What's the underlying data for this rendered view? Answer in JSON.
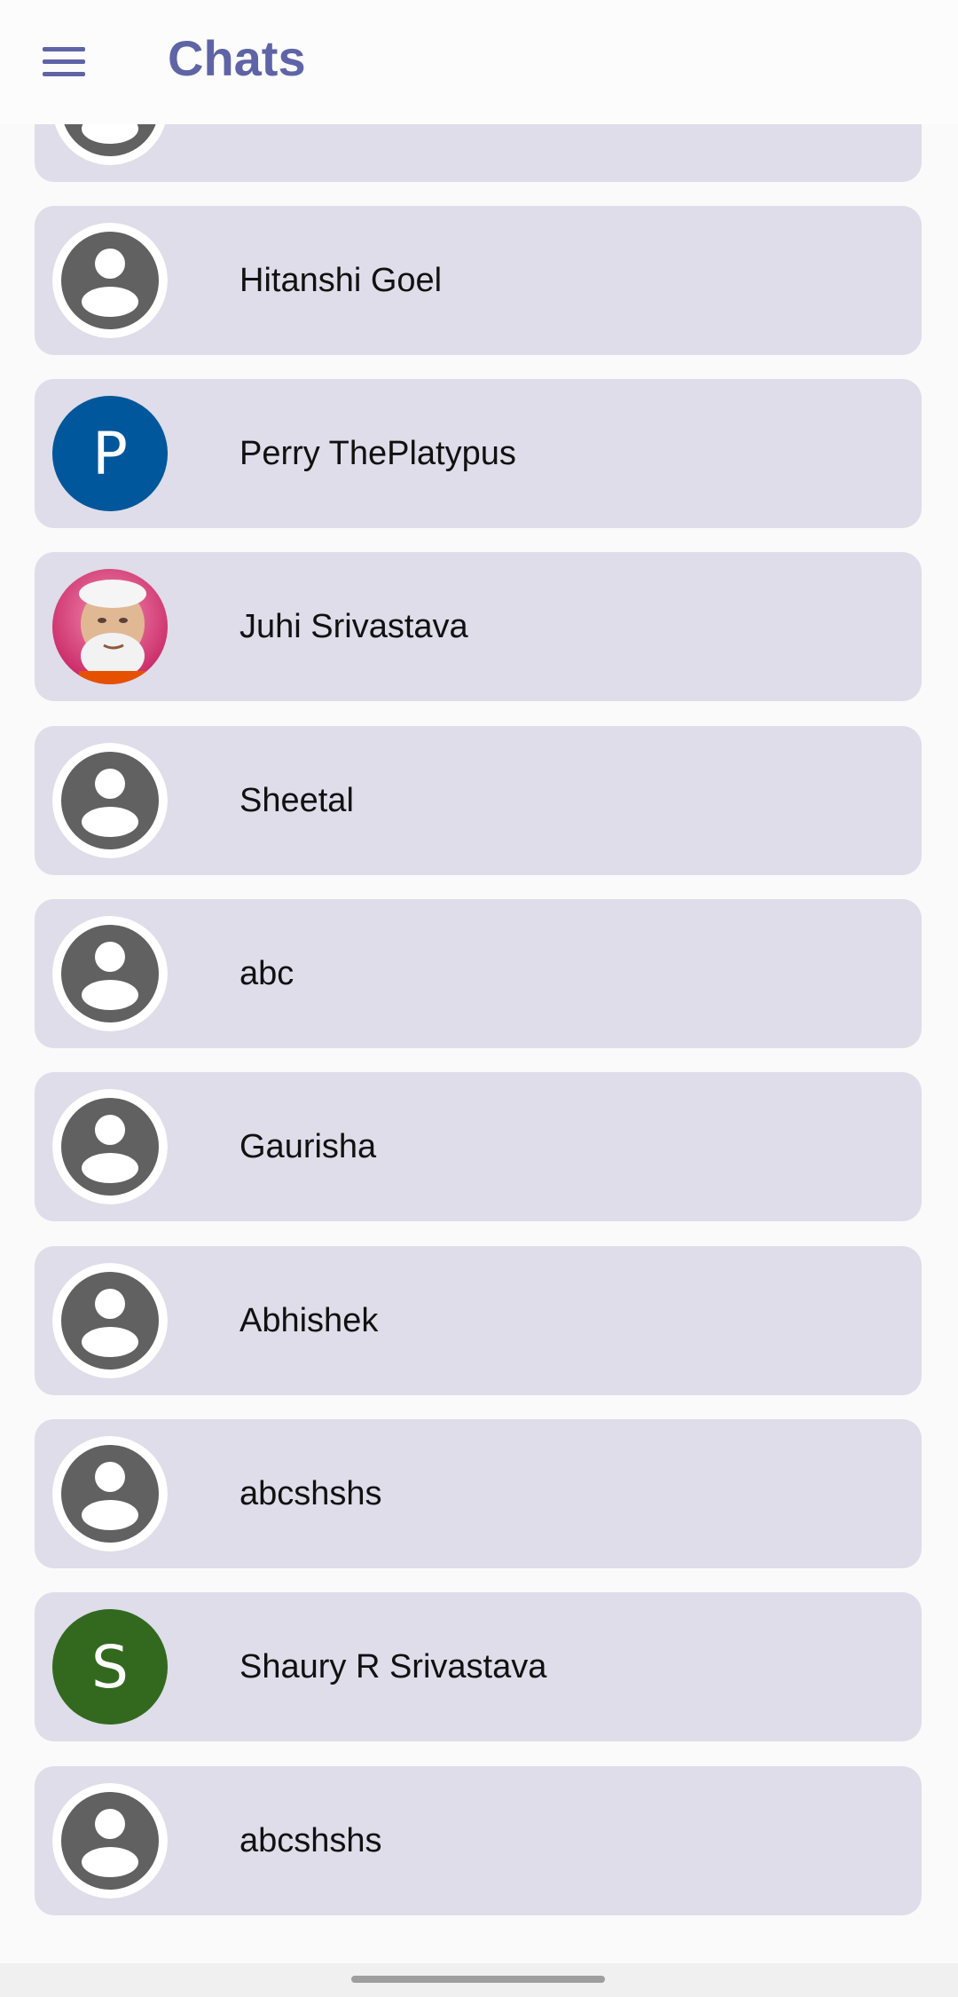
{
  "header": {
    "title": "Chats",
    "menu_icon": "hamburger-menu-icon"
  },
  "colors": {
    "accent": "#5e64a6",
    "card": "#dedde9",
    "default_avatar": "#616161",
    "avatar_p": "#01579b",
    "avatar_s": "#33691e"
  },
  "chats": [
    {
      "name": "",
      "avatar": "default-person-icon"
    },
    {
      "name": "Hitanshi Goel",
      "avatar": "default-person-icon"
    },
    {
      "name": "Perry ThePlatypus",
      "avatar": "letter",
      "letter": "P",
      "color": "#01579b"
    },
    {
      "name": "Juhi Srivastava",
      "avatar": "photo"
    },
    {
      "name": "Sheetal",
      "avatar": "default-person-icon"
    },
    {
      "name": "abc",
      "avatar": "default-person-icon"
    },
    {
      "name": "Gaurisha",
      "avatar": "default-person-icon"
    },
    {
      "name": "Abhishek",
      "avatar": "default-person-icon"
    },
    {
      "name": "abcshshs",
      "avatar": "default-person-icon"
    },
    {
      "name": "Shaury R Srivastava",
      "avatar": "letter",
      "letter": "S",
      "color": "#33691e"
    },
    {
      "name": "abcshshs",
      "avatar": "default-person-icon"
    }
  ]
}
